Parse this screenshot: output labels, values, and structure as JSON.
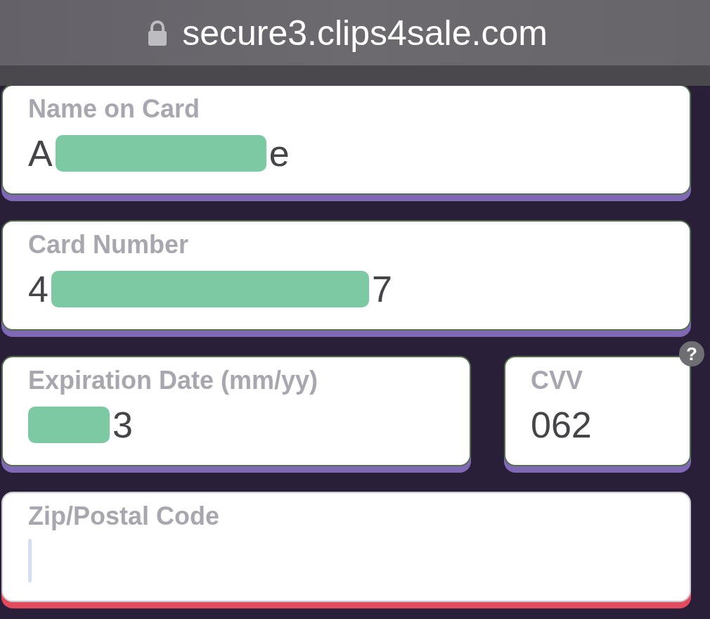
{
  "browser_bar": {
    "secure": true,
    "url": "secure3.clips4sale.com"
  },
  "form": {
    "rows": [
      {
        "fields": [
          {
            "label": "Name on Card",
            "redacted": true,
            "value_before": "A",
            "value_after": "e",
            "valid": true,
            "focused": false
          }
        ]
      },
      {
        "fields": [
          {
            "label": "Card Number",
            "redacted": true,
            "value_before": "4",
            "value_after": "7",
            "valid": true,
            "focused": false
          }
        ]
      },
      {
        "fields": [
          {
            "label": "Expiration Date (mm/yy)",
            "redacted": true,
            "value_after": "3",
            "valid": true,
            "focused": false
          },
          {
            "label": "CVV",
            "redacted": false,
            "value": "062",
            "valid": true,
            "focused": false,
            "help": "?"
          }
        ]
      },
      {
        "fields": [
          {
            "label": "Zip/Postal Code",
            "redacted": false,
            "valid": false,
            "focused": true
          }
        ]
      }
    ]
  }
}
